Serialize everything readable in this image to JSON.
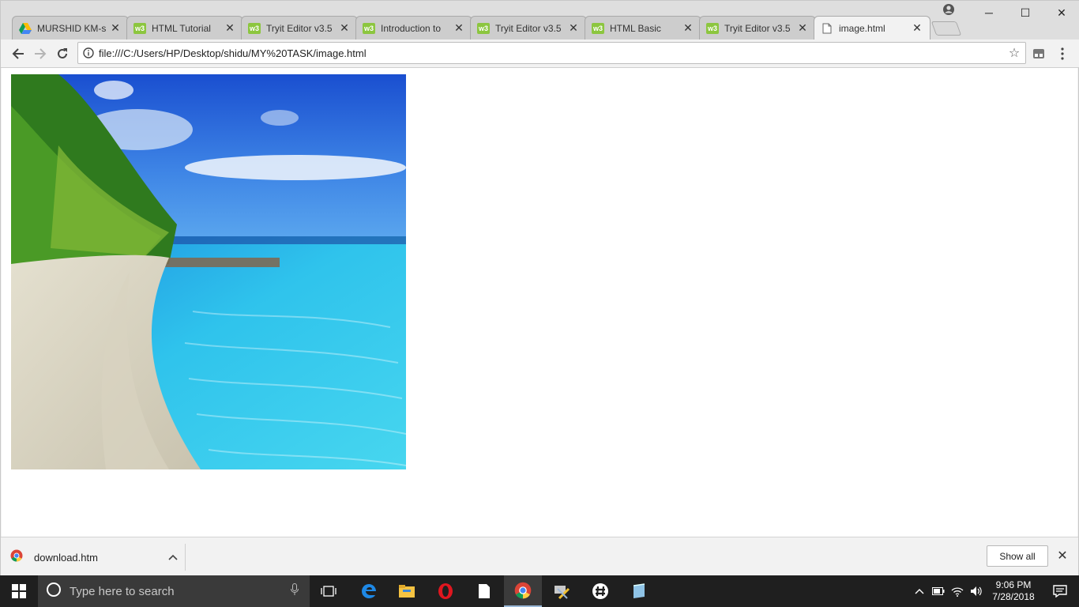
{
  "browser": {
    "tabs": [
      {
        "title": "MURSHID KM-s",
        "favicon": "google-drive-icon",
        "active": false
      },
      {
        "title": "HTML Tutorial",
        "favicon": "w3schools-icon",
        "active": false
      },
      {
        "title": "Tryit Editor v3.5",
        "favicon": "w3schools-icon",
        "active": false
      },
      {
        "title": "Introduction to",
        "favicon": "w3schools-icon",
        "active": false
      },
      {
        "title": "Tryit Editor v3.5",
        "favicon": "w3schools-icon",
        "active": false
      },
      {
        "title": "HTML Basic",
        "favicon": "w3schools-icon",
        "active": false
      },
      {
        "title": "Tryit Editor v3.5",
        "favicon": "w3schools-icon",
        "active": false
      },
      {
        "title": "image.html",
        "favicon": "file-icon",
        "active": true
      }
    ],
    "favicon_glyph": "w3",
    "address": "file:///C:/Users/HP/Desktop/shidu/MY%20TASK/image.html",
    "page_image": "beach-image"
  },
  "downloads": {
    "file_name": "download.htm",
    "show_all_label": "Show all"
  },
  "taskbar": {
    "search_placeholder": "Type here to search",
    "time": "9:06 PM",
    "date": "7/28/2018"
  }
}
